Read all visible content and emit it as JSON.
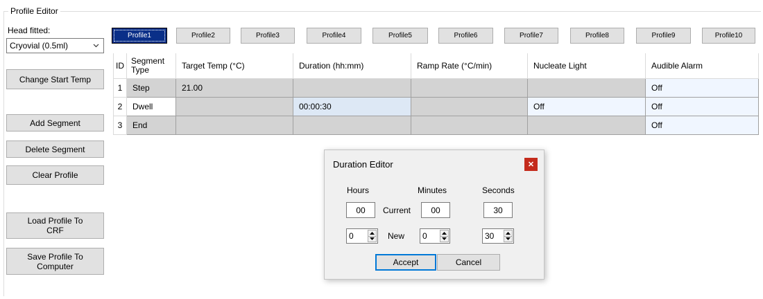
{
  "group_title": "Profile Editor",
  "head": {
    "label": "Head fitted:",
    "selected": "Cryovial (0.5ml)",
    "arrow_icon": "chevron-down-icon"
  },
  "left_buttons": {
    "change_start_temp": "Change Start Temp",
    "add_segment": "Add Segment",
    "delete_segment": "Delete Segment",
    "clear_profile": "Clear Profile",
    "load_profile": "Load Profile To CRF",
    "save_profile": "Save Profile To Computer"
  },
  "profiles": [
    "Profile1",
    "Profile2",
    "Profile3",
    "Profile4",
    "Profile5",
    "Profile6",
    "Profile7",
    "Profile8",
    "Profile9",
    "Profile10"
  ],
  "active_profile": "Profile1",
  "grid": {
    "headers": [
      "ID",
      "Segment Type",
      "Target Temp (°C)",
      "Duration (hh:mm)",
      "Ramp Rate (°C/min)",
      "Nucleate Light",
      "Audible Alarm"
    ],
    "rows": [
      [
        "1",
        "Step",
        "21.00",
        "",
        "",
        "",
        "Off"
      ],
      [
        "2",
        "Dwell",
        "",
        "00:00:30",
        "",
        "Off",
        "Off"
      ],
      [
        "3",
        "End",
        "",
        "",
        "",
        "",
        "Off"
      ]
    ]
  },
  "dialog": {
    "title": "Duration Editor",
    "close_icon": "close-icon",
    "hours_label": "Hours",
    "minutes_label": "Minutes",
    "seconds_label": "Seconds",
    "current_label": "Current",
    "new_label": "New",
    "current": {
      "hours": "00",
      "minutes": "00",
      "seconds": "30"
    },
    "new": {
      "hours": "0",
      "minutes": "0",
      "seconds": "30"
    },
    "accept": "Accept",
    "cancel": "Cancel"
  },
  "colors": {
    "active_tab": "#0a2f88",
    "gray_cell": "#d3d3d3",
    "blue_cell": "#f0f6ff",
    "selected_cell": "#dde8f5",
    "close_button": "#c42b1c"
  }
}
